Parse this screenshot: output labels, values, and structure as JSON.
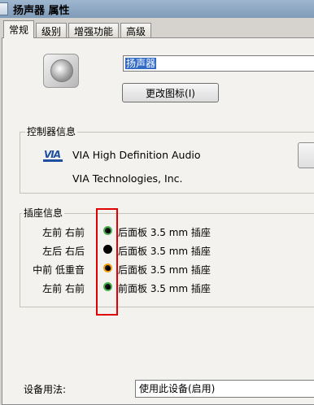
{
  "window": {
    "title": "扬声器  属性"
  },
  "tabs": [
    {
      "label": "常规",
      "active": true
    },
    {
      "label": "级别",
      "active": false
    },
    {
      "label": "增强功能",
      "active": false
    },
    {
      "label": "高级",
      "active": false
    }
  ],
  "device": {
    "name": "扬声器",
    "change_icon_label": "更改图标(I)"
  },
  "controller": {
    "section_label": "控制器信息",
    "name": "VIA High Definition Audio",
    "vendor": "VIA Technologies, Inc.",
    "logo_text": "VIA"
  },
  "jacks": {
    "section_label": "插座信息",
    "items": [
      {
        "channels": "左前  右前",
        "description": "后面板 3.5 mm 插座",
        "color": "#4caf50"
      },
      {
        "channels": "左后  右后",
        "description": "后面板 3.5 mm 插座",
        "color": "#000000"
      },
      {
        "channels": "中前  低重音",
        "description": "后面板 3.5 mm 插座",
        "color": "#f39c12"
      },
      {
        "channels": "左前  右前",
        "description": "前面板 3.5 mm 插座",
        "color": "#4caf50"
      }
    ]
  },
  "usage": {
    "label": "设备用法:",
    "value": "使用此设备(启用)"
  },
  "colors": {
    "highlight": "#e00000",
    "selection": "#316ac5"
  }
}
